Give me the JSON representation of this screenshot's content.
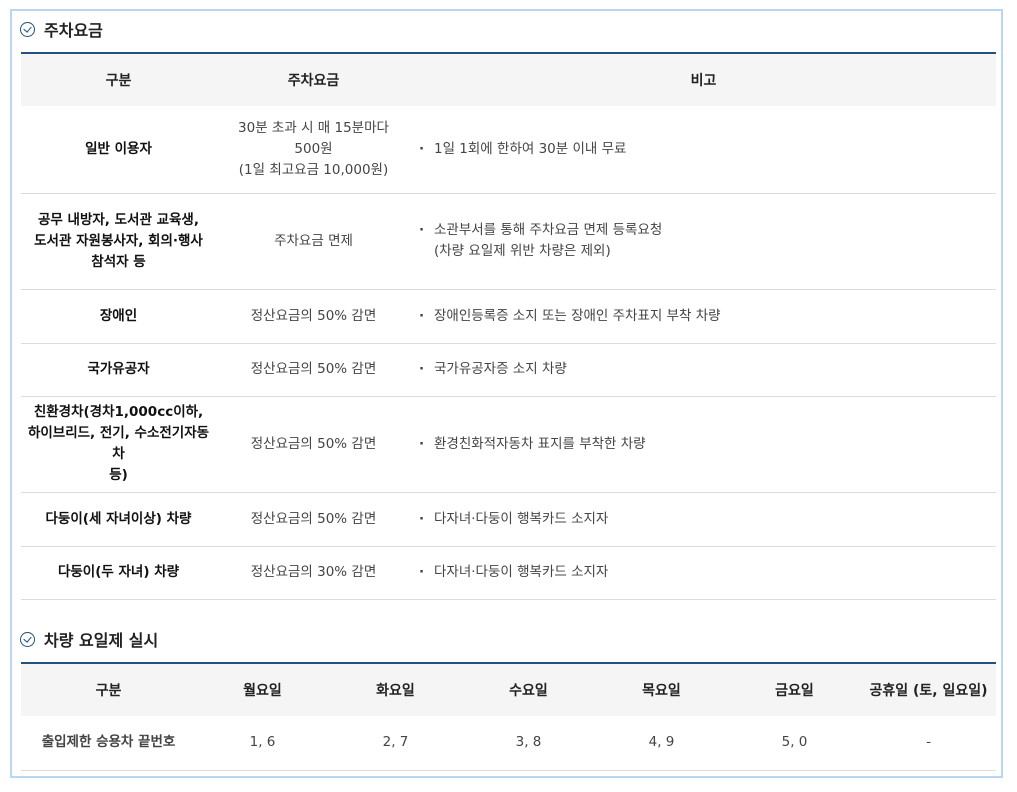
{
  "fee_section": {
    "title": "주차요금",
    "headers": [
      "구분",
      "주차요금",
      "비고"
    ],
    "rows": [
      {
        "category": [
          "일반 이용자"
        ],
        "fee": [
          "30분 초과 시 매 15분마다",
          "500원",
          "(1일 최고요금 10,000원)"
        ],
        "note": [
          "1일 1회에 한하여 30분 이내 무료"
        ]
      },
      {
        "category": [
          "공무 내방자, 도서관 교육생,",
          "도서관 자원봉사자, 회의·행사",
          "참석자 등"
        ],
        "fee": [
          "주차요금 면제"
        ],
        "note": [
          "소관부서를 통해 주차요금 면제 등록요청",
          "(차량 요일제 위반 차량은 제외)"
        ]
      },
      {
        "category": [
          "장애인"
        ],
        "fee": [
          "정산요금의 50% 감면"
        ],
        "note": [
          "장애인등록증 소지 또는 장애인 주차표지 부착 차량"
        ]
      },
      {
        "category": [
          "국가유공자"
        ],
        "fee": [
          "정산요금의 50% 감면"
        ],
        "note": [
          "국가유공자증 소지 차량"
        ]
      },
      {
        "category": [
          "친환경차(경차1,000cc이하,",
          "하이브리드, 전기, 수소전기자동차",
          "등)"
        ],
        "fee": [
          "정산요금의 50% 감면"
        ],
        "note": [
          "환경친화적자동차 표지를 부착한 차량"
        ]
      },
      {
        "category": [
          "다둥이(세 자녀이상) 차량"
        ],
        "fee": [
          "정산요금의 50% 감면"
        ],
        "note": [
          "다자녀·다둥이 행복카드 소지자"
        ]
      },
      {
        "category": [
          "다둥이(두 자녀) 차량"
        ],
        "fee": [
          "정산요금의 30% 감면"
        ],
        "note": [
          "다자녀·다둥이 행복카드 소지자"
        ]
      }
    ]
  },
  "rotation_section": {
    "title": "차량 요일제 실시",
    "headers": [
      "구분",
      "월요일",
      "화요일",
      "수요일",
      "목요일",
      "금요일",
      "공휴일 (토, 일요일)"
    ],
    "row": [
      "출입제한 승용차 끝번호",
      "1, 6",
      "2, 7",
      "3, 8",
      "4, 9",
      "5, 0",
      "-"
    ]
  },
  "colors": {
    "accent": "#24517e",
    "frame": "#b9d6f2",
    "header_bg": "#f5f5f5"
  },
  "icons": {
    "section": "check-circle-icon"
  }
}
